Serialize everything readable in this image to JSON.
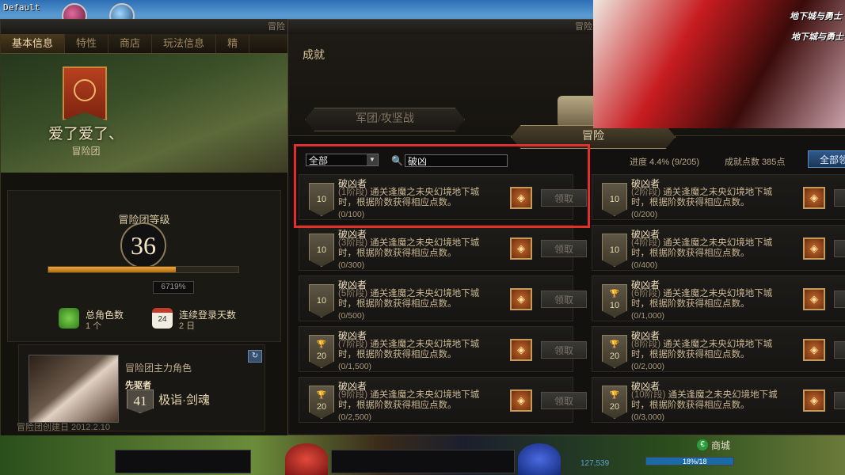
{
  "top": {
    "profile_tag": "Default"
  },
  "left_panel": {
    "window_title": "冒险",
    "tabs": [
      "基本信息",
      "特性",
      "商店",
      "玩法信息",
      "精"
    ],
    "guild_name": "爱了爱了、",
    "guild_sub": "冒险团",
    "level_label": "冒险团等级",
    "level": "36",
    "exp_fraction": 0.6719,
    "exp_text": "6719%",
    "stats": [
      {
        "label": "总角色数",
        "value": "1 个",
        "icon": "characters-icon"
      },
      {
        "label": "连续登录天数",
        "value": "2 日",
        "icon": "calendar-icon",
        "icon_text": "24"
      }
    ],
    "main_char": {
      "label": "冒险团主力角色",
      "job": "先驱者",
      "level": "41",
      "name": "极诣·剑魂"
    },
    "created_text": "冒险团创建日 2012.2.10"
  },
  "achievement": {
    "window_title": "冒险",
    "title": "成就",
    "tab_legion": "军团/攻坚战",
    "tab_adventure": "冒险",
    "filter_value": "全部",
    "search_value": "破凶",
    "progress_text": "进度  4.4% (9/205)",
    "points_text": "成就点数 385点",
    "all_button": "全部领",
    "claim_label": "领取",
    "cards": [
      {
        "title": "破凶者",
        "desc_stage": "(1阶段)",
        "desc": "通关逢魔之未央幻境地下城时，根据阶数获得相应点数。",
        "count": "(0/100)",
        "badge": "10",
        "trophy": false
      },
      {
        "title": "破凶者",
        "desc_stage": "(2阶段)",
        "desc": "通关逢魔之未央幻境地下城时，根据阶数获得相应点数。",
        "count": "(0/200)",
        "badge": "10",
        "trophy": false
      },
      {
        "title": "破凶者",
        "desc_stage": "(3阶段)",
        "desc": "通关逢魔之未央幻境地下城时，根据阶数获得相应点数。",
        "count": "(0/300)",
        "badge": "10",
        "trophy": false
      },
      {
        "title": "破凶者",
        "desc_stage": "(4阶段)",
        "desc": "通关逢魔之未央幻境地下城时，根据阶数获得相应点数。",
        "count": "(0/400)",
        "badge": "10",
        "trophy": false
      },
      {
        "title": "破凶者",
        "desc_stage": "(5阶段)",
        "desc": "通关逢魔之未央幻境地下城时，根据阶数获得相应点数。",
        "count": "(0/500)",
        "badge": "10",
        "trophy": false
      },
      {
        "title": "破凶者",
        "desc_stage": "(6阶段)",
        "desc": "通关逢魔之未央幻境地下城时，根据阶数获得相应点数。",
        "count": "(0/1,000)",
        "badge": "10",
        "trophy": true
      },
      {
        "title": "破凶者",
        "desc_stage": "(7阶段)",
        "desc": "通关逢魔之未央幻境地下城时，根据阶数获得相应点数。",
        "count": "(0/1,500)",
        "badge": "20",
        "trophy": true
      },
      {
        "title": "破凶者",
        "desc_stage": "(8阶段)",
        "desc": "通关逢魔之未央幻境地下城时，根据阶数获得相应点数。",
        "count": "(0/2,000)",
        "badge": "20",
        "trophy": true
      },
      {
        "title": "破凶者",
        "desc_stage": "(9阶段)",
        "desc": "通关逢魔之未央幻境地下城时，根据阶数获得相应点数。",
        "count": "(0/2,500)",
        "badge": "20",
        "trophy": true
      },
      {
        "title": "破凶者",
        "desc_stage": "(10阶段)",
        "desc": "通关逢魔之未央幻境地下城时，根据阶数获得相应点数。",
        "count": "(0/3,000)",
        "badge": "20",
        "trophy": true
      }
    ]
  },
  "ad": {
    "logo1": "地下城与勇士",
    "logo2": "地下城与勇士"
  },
  "bottom": {
    "shop_label": "商城",
    "gold": "127,539",
    "hp": "18%/18"
  },
  "colors": {
    "highlight": "#e0302b",
    "accent": "#d8c39a",
    "claim_disabled": "#7c7566"
  }
}
